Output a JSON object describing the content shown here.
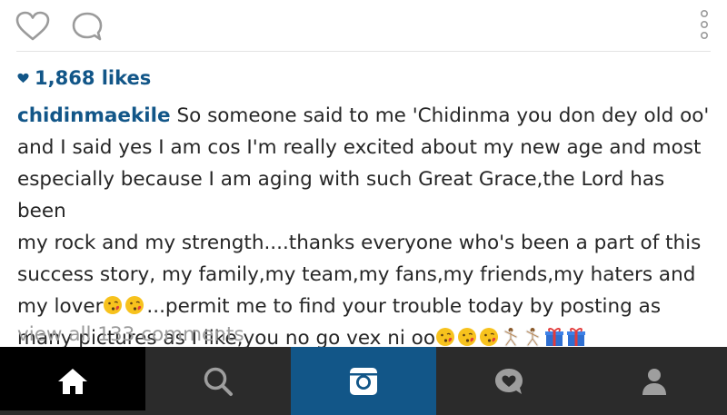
{
  "post": {
    "likes_count": "1,868 likes",
    "username": "chidinmaekile",
    "caption_lines": [
      " So someone said to me 'Chidinma you don dey old oo'",
      "and I said yes I am cos I'm really excited about my new age and most",
      "especially because I am aging with such Great Grace,the Lord has been",
      "my rock and my strength....thanks everyone who's been a part of this",
      "success story, my family,my team,my fans,my friends,my haters and"
    ],
    "caption_line6_a": "my lover",
    "caption_line6_b": "...permit me to find your trouble today by posting as",
    "caption_line7": "many pictures as I like,you no go vex ni oo",
    "view_comments": "view all 133 comments"
  },
  "icons": {
    "like": "heart-outline-icon",
    "comment": "comment-bubble-icon",
    "more": "more-vertical-icon",
    "emoji_kiss": "kissing-face-emoji",
    "emoji_dancer": "dancer-emoji",
    "emoji_gift": "gift-emoji"
  },
  "nav": {
    "tabs": [
      "home",
      "search",
      "camera",
      "activity",
      "profile"
    ]
  },
  "colors": {
    "link_blue": "#125688",
    "text": "#262626",
    "muted": "#9a9a9a",
    "nav_dark": "#2b2b2b",
    "nav_active": "#000000",
    "camera_accent": "#125688"
  }
}
